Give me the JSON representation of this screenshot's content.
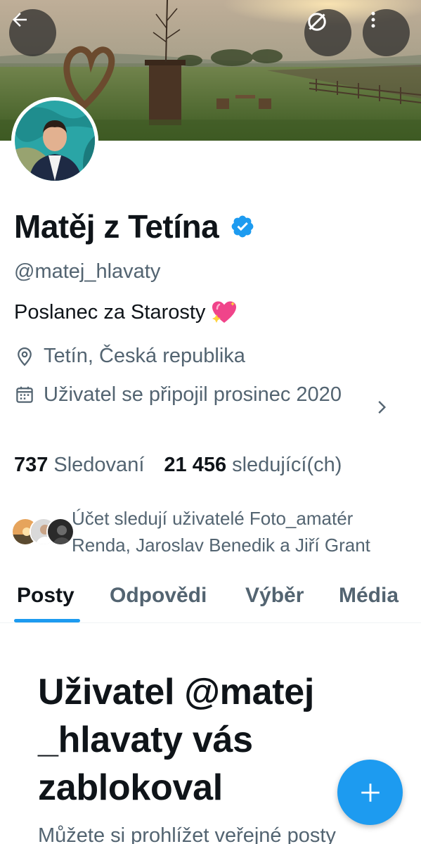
{
  "header": {
    "back_icon": "arrow-left-icon",
    "translate_icon": "no-translate-icon",
    "more_icon": "more-vertical-icon"
  },
  "profile": {
    "name": "Matěj z Tetína",
    "verified": true,
    "handle": "@matej_hlavaty",
    "bio": "Poslanec za Starosty",
    "bio_emoji": "sparkling-heart-icon",
    "location": "Tetín, Česká republika",
    "joined": "Uživatel se připojil prosinec 2020",
    "following_count": "737",
    "following_label": "Sledovaní",
    "followers_count": "21 456",
    "followers_label": "sledující(ch)",
    "followed_by": "Účet sledují uživatelé Foto_amatér Renda, Jaroslav Benedik a Jiří Grant"
  },
  "tabs": [
    {
      "label": "Posty",
      "active": true
    },
    {
      "label": "Odpovědi",
      "active": false
    },
    {
      "label": "Výběr",
      "active": false
    },
    {
      "label": "Média",
      "active": false
    }
  ],
  "blocked": {
    "title": "Uživatel @matej _hlavaty vás zablokoval",
    "subtitle": "Můžete si prohlížet veřejné posty"
  },
  "colors": {
    "accent": "#1d9bf0",
    "text_primary": "#0f1419",
    "text_secondary": "#536471"
  }
}
